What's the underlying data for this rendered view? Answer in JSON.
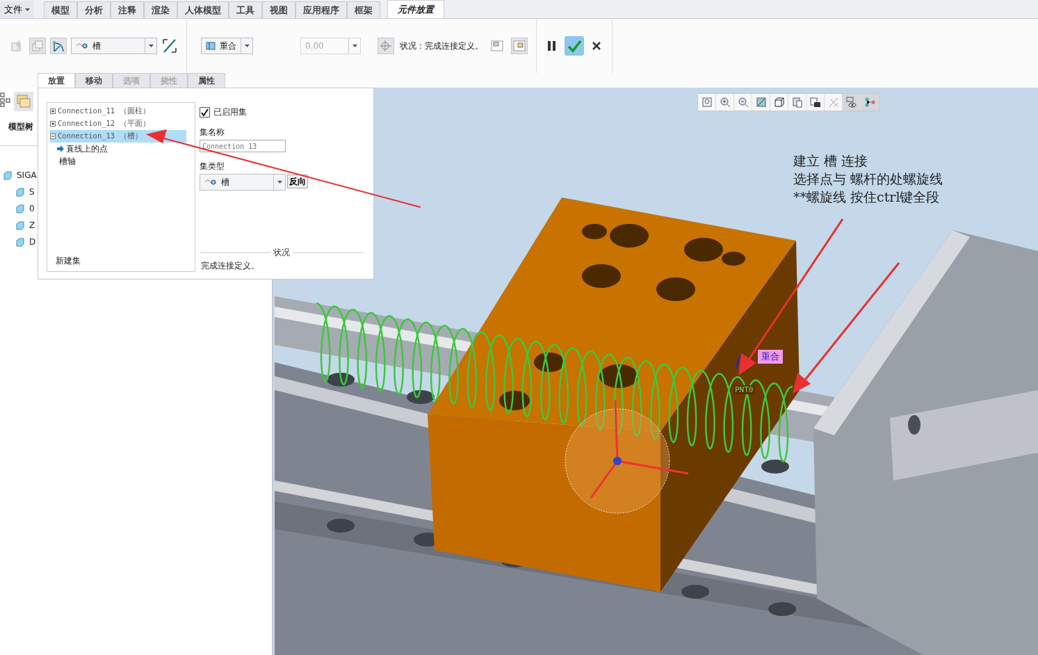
{
  "menu": {
    "file": "文件",
    "tabs": [
      {
        "label": "模型",
        "selected": false
      },
      {
        "label": "分析",
        "selected": false
      },
      {
        "label": "注释",
        "selected": false
      },
      {
        "label": "渲染",
        "selected": false
      },
      {
        "label": "人体模型",
        "selected": false
      },
      {
        "label": "工具",
        "selected": false
      },
      {
        "label": "视图",
        "selected": false
      },
      {
        "label": "应用程序",
        "selected": false
      },
      {
        "label": "框架",
        "selected": false
      },
      {
        "label": "元件放置",
        "selected": true
      }
    ]
  },
  "ribbon": {
    "connection_type": "槽",
    "constraint": "重合",
    "offset": {
      "value": "0.00",
      "disabled": true
    },
    "status": "状况：完成连接定义。"
  },
  "sub_tabs": [
    {
      "label": "放置",
      "selected": true,
      "disabled": false
    },
    {
      "label": "移动",
      "selected": false,
      "disabled": false
    },
    {
      "label": "选项",
      "selected": false,
      "disabled": true
    },
    {
      "label": "挠性",
      "selected": false,
      "disabled": true
    },
    {
      "label": "属性",
      "selected": false,
      "disabled": false
    }
  ],
  "model_tree": {
    "label": "模型树",
    "items": [
      "SIGA",
      "S",
      "0",
      "Z",
      "D"
    ]
  },
  "placement": {
    "sets": [
      {
        "label": "Connection_11 （圆柱）",
        "expanded": false,
        "selected": false
      },
      {
        "label": "Connection_12 （平面）",
        "expanded": false,
        "selected": false
      },
      {
        "label": "Connection_13 （槽）",
        "expanded": true,
        "selected": true,
        "children": [
          {
            "label": "直线上的点",
            "current": true
          },
          {
            "label": "槽轴",
            "current": false
          }
        ]
      }
    ],
    "new_set": "新建集",
    "enabled_set": {
      "label": "已启用集",
      "checked": true
    },
    "set_name": {
      "label": "集名称",
      "value": "Connection_13"
    },
    "set_type": {
      "label": "集类型",
      "value": "槽"
    },
    "flip_button": "反向",
    "status": {
      "heading": "状况",
      "text": "完成连接定义。"
    }
  },
  "viewport": {
    "toolbar": [
      {
        "kind": "refit",
        "on": false
      },
      {
        "kind": "zoom-in",
        "on": false
      },
      {
        "kind": "zoom-out",
        "on": false
      },
      {
        "kind": "repaint",
        "on": false
      },
      {
        "kind": "display-style",
        "on": false
      },
      {
        "kind": "saved-views",
        "on": false
      },
      {
        "kind": "snapshot",
        "on": false
      },
      {
        "kind": "datum",
        "on": false
      },
      {
        "kind": "hidden",
        "on": true
      },
      {
        "kind": "connection",
        "on": true
      }
    ],
    "annotation": [
      "建立 槽 连接",
      "选择点与 螺杆的处螺旋线",
      "**螺旋线 按住ctrl键全段"
    ],
    "callout": "重合",
    "point_label": "PNT0"
  }
}
